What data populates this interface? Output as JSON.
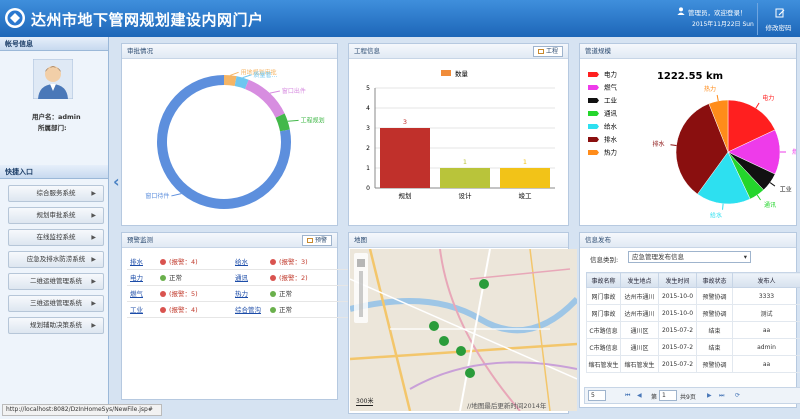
{
  "header": {
    "title": "达州市地下管网规划建设内网门户",
    "user_greeting": "管理员，欢迎登录！",
    "date": "2015年11月22日 Sun",
    "change_pwd": "修改密码"
  },
  "sidebar": {
    "account_title": "帐号信息",
    "user_name": "用户名：admin",
    "dept": "所属部门:",
    "quick_title": "快捷入口",
    "items": [
      "综合服务系统",
      "规划审批系统",
      "在线监控系统",
      "应急及排水防涝系统",
      "二维运维管理系统",
      "三维运维管理系统",
      "规划辅助决策系统"
    ],
    "arrow": "▶"
  },
  "approval": {
    "title": "审批情况",
    "labels": {
      "land": "用地规划审批",
      "manage": "质量管...",
      "window_out": "窗口出件",
      "engineering": "工程规划",
      "window_pending": "窗口待件"
    }
  },
  "project": {
    "title": "工程信息",
    "button": "工程",
    "legend": "数量"
  },
  "pipe": {
    "title": "管道规模",
    "total": "1222.55 km",
    "legend": [
      "电力",
      "燃气",
      "工业",
      "通讯",
      "给水",
      "排水",
      "热力"
    ],
    "slice_labels": {
      "power": "电力",
      "gas": "燃气",
      "industry": "工业",
      "telecom": "通讯",
      "water": "给水",
      "drain": "排水",
      "heat": "热力"
    }
  },
  "warning": {
    "title": "预警监测",
    "button": "预警",
    "rows": [
      [
        {
          "name": "排水",
          "status": "(报警：4)",
          "alarm": true
        },
        {
          "name": "给水",
          "status": "(报警：3)",
          "alarm": true
        }
      ],
      [
        {
          "name": "电力",
          "status": "正常",
          "alarm": false
        },
        {
          "name": "通讯",
          "status": "(报警：2)",
          "alarm": true
        }
      ],
      [
        {
          "name": "燃气",
          "status": "(报警：5)",
          "alarm": true
        },
        {
          "name": "热力",
          "status": "正常",
          "alarm": false
        }
      ],
      [
        {
          "name": "工业",
          "status": "(报警：4)",
          "alarm": true
        },
        {
          "name": "综合管沟",
          "status": "正常",
          "alarm": false
        }
      ]
    ]
  },
  "map": {
    "title": "地图",
    "scale": "300米",
    "update": "//地图最后更新时间2014年"
  },
  "info": {
    "title": "信息发布",
    "category_label": "信息类别:",
    "category_value": "应急管理发布信息",
    "headers": [
      "事故名称",
      "发生地点",
      "发生时间",
      "事故状态",
      "发布人"
    ],
    "rows": [
      [
        "网门事故",
        "达州市通川",
        "2015-10-0",
        "预警协调",
        "3333"
      ],
      [
        "网门事故",
        "达州市通川",
        "2015-10-0",
        "预警协调",
        "测试"
      ],
      [
        "C市路信息",
        "通川区",
        "2015-07-2",
        "结束",
        "aa"
      ],
      [
        "C市路信息",
        "通川区",
        "2015-07-2",
        "结束",
        "admin"
      ],
      [
        "缩石管发生",
        "缩石管发生",
        "2015-07-2",
        "预警协调",
        "aa"
      ]
    ],
    "pager": {
      "size": "5",
      "page_label": "第",
      "page": "1",
      "total": "共9页"
    }
  },
  "status_url": "http://localhost:8082/DzInHomeSys/NewFile.jsp#",
  "chart_data": [
    {
      "type": "bar",
      "title": "",
      "categories": [
        "规划",
        "设计",
        "竣工"
      ],
      "values": [
        3,
        1,
        1
      ],
      "series": [
        {
          "name": "数量",
          "values": [
            3,
            1,
            1
          ]
        }
      ],
      "ylim": [
        0,
        5
      ],
      "yticks": [
        0,
        1,
        2,
        3,
        4,
        5
      ],
      "colors": [
        "#c0302b",
        "#b9c43a",
        "#f2c318"
      ]
    },
    {
      "type": "pie",
      "title": "",
      "total_label": "1222.55 km",
      "categories": [
        "电力",
        "燃气",
        "工业",
        "通讯",
        "给水",
        "排水",
        "热力"
      ],
      "values": [
        18,
        14,
        6,
        5,
        17,
        34,
        6
      ],
      "colors": [
        "#ff1f1f",
        "#ee3bea",
        "#111111",
        "#24d62c",
        "#2de0f0",
        "#8a0f0f",
        "#ff8c1a"
      ]
    },
    {
      "type": "pie",
      "title": "",
      "categories": [
        "用地规划审批",
        "质量管...",
        "窗口出件",
        "工程规划",
        "窗口待件"
      ],
      "values": [
        3,
        3,
        12,
        4,
        78
      ],
      "colors": [
        "#f5b565",
        "#6ec6f0",
        "#d78de0",
        "#43b84a",
        "#5d8fdd"
      ]
    }
  ]
}
